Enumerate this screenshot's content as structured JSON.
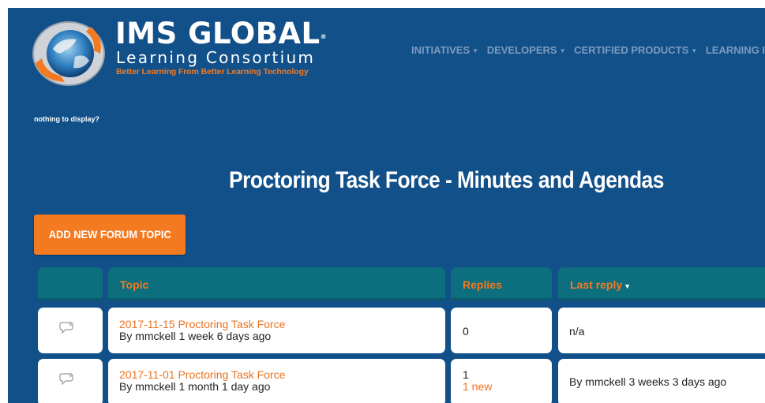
{
  "brand": {
    "name": "IMS GLOBAL",
    "registered_mark": "®",
    "subtitle": "Learning Consortium",
    "tagline": "Better Learning From Better Learning Technology"
  },
  "nav": {
    "items": [
      {
        "label": "INITIATIVES"
      },
      {
        "label": "DEVELOPERS"
      },
      {
        "label": "CERTIFIED PRODUCTS"
      },
      {
        "label": "LEARNING I"
      }
    ]
  },
  "notice": "nothing to display?",
  "page_title": "Proctoring Task Force - Minutes and Agendas",
  "add_topic_label": "ADD NEW FORUM TOPIC",
  "table": {
    "headers": {
      "topic": "Topic",
      "replies": "Replies",
      "last_reply": "Last reply"
    },
    "rows": [
      {
        "topic": "2017-11-15 Proctoring Task Force",
        "by": "By mmckell 1 week 6 days ago",
        "replies": "0",
        "new": "",
        "last_reply": "n/a"
      },
      {
        "topic": "2017-11-01 Proctoring Task Force",
        "by": "By mmckell 1 month 1 day ago",
        "replies": "1",
        "new": "1 new",
        "last_reply": "By mmckell 3 weeks 3 days ago"
      }
    ]
  },
  "colors": {
    "background": "#12508a",
    "accent": "#f37a21",
    "table_header": "#0d6f7e",
    "nav_text": "#7d9bbf"
  },
  "icons": {
    "logo": "globe-logo-icon",
    "row_status": "forum-topic-icon",
    "sort": "caret-down-icon"
  }
}
